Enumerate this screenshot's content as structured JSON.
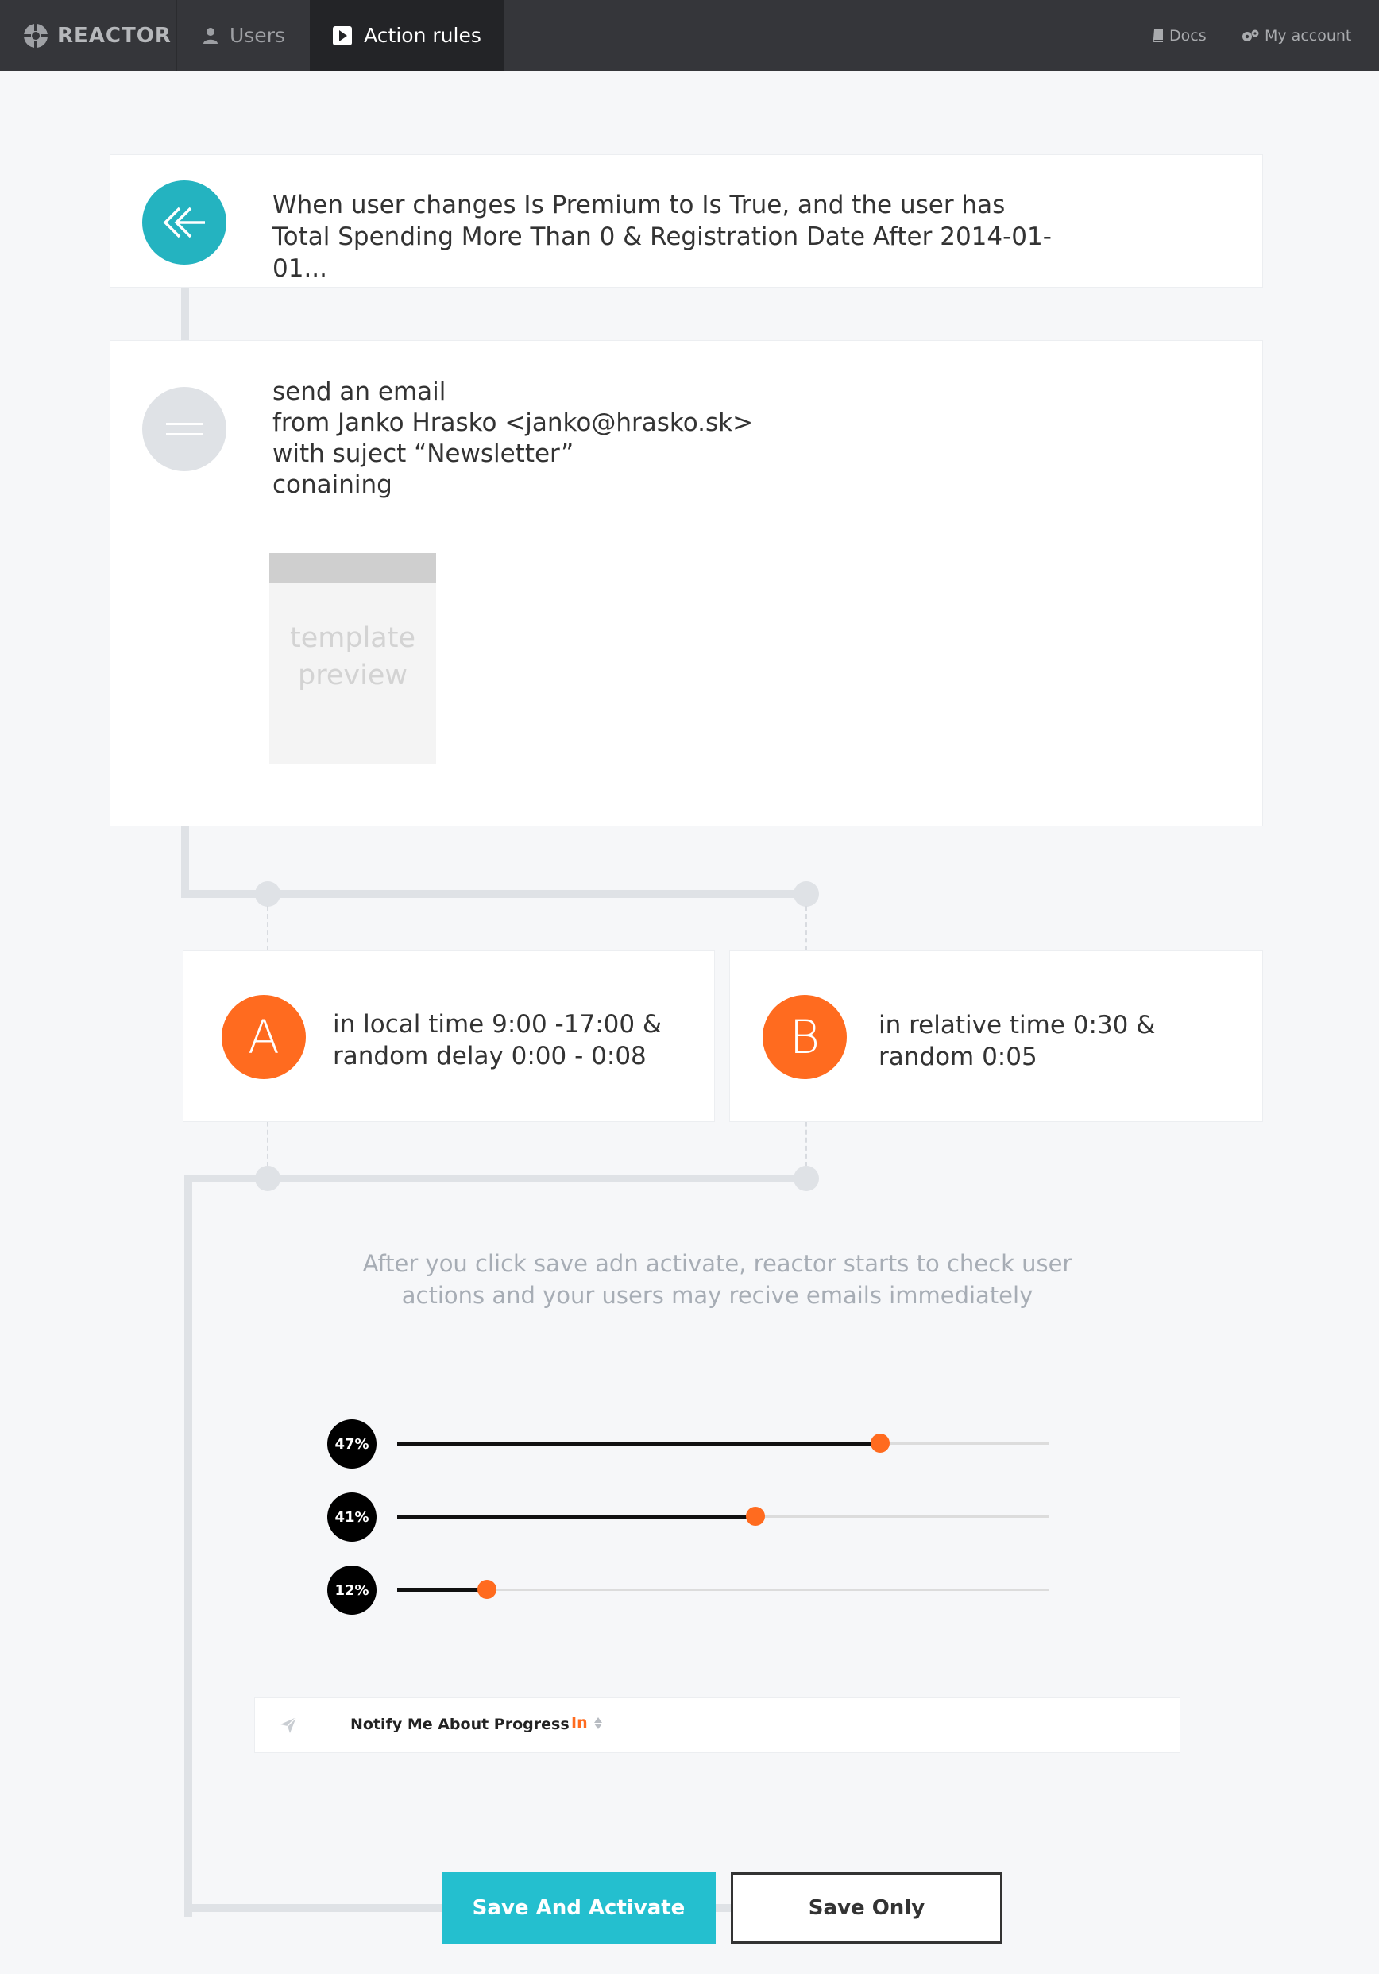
{
  "nav": {
    "brand": "REACTOR",
    "tabs": [
      {
        "label": "Users",
        "icon": "user-icon"
      },
      {
        "label": "Action rules",
        "icon": "play-icon"
      }
    ],
    "docs_label": "Docs",
    "account_label": "My account"
  },
  "trigger": {
    "text": "When user changes Is Premium to Is True, and the user has Total Spending More Than 0 & Registration Date After 2014-01-01...",
    "icon": "double-chevron-left-icon"
  },
  "email_action": {
    "icon": "equals-icon",
    "lines": [
      "send an email",
      "from Janko Hrasko <janko@hrasko.sk>",
      "with suject “Newsletter”",
      "conaining"
    ],
    "template_preview": "template preview"
  },
  "branches": [
    {
      "letter": "A",
      "line1": "in local time 9:00 -17:00 &",
      "line2": "random delay 0:00 - 0:08"
    },
    {
      "letter": "B",
      "line1": "in relative time 0:30 &",
      "line2": "random 0:05"
    }
  ],
  "info_text": "After you click save adn activate, reactor starts to check user actions and your users may recive emails immediately",
  "sliders": [
    {
      "label": "47%",
      "value": 0.74
    },
    {
      "label": "41%",
      "value": 0.549
    },
    {
      "label": "12%",
      "value": 0.138
    }
  ],
  "notify": {
    "label": "Notify Me About Progress",
    "value": "In",
    "icon": "paper-plane-icon"
  },
  "buttons": {
    "activate": "Save And Activate",
    "save_only": "Save Only"
  },
  "colors": {
    "teal": "#24b3c0",
    "orange": "#ff6b1f",
    "nav_bg": "#35363a",
    "line_gray": "#dfe2e6"
  }
}
